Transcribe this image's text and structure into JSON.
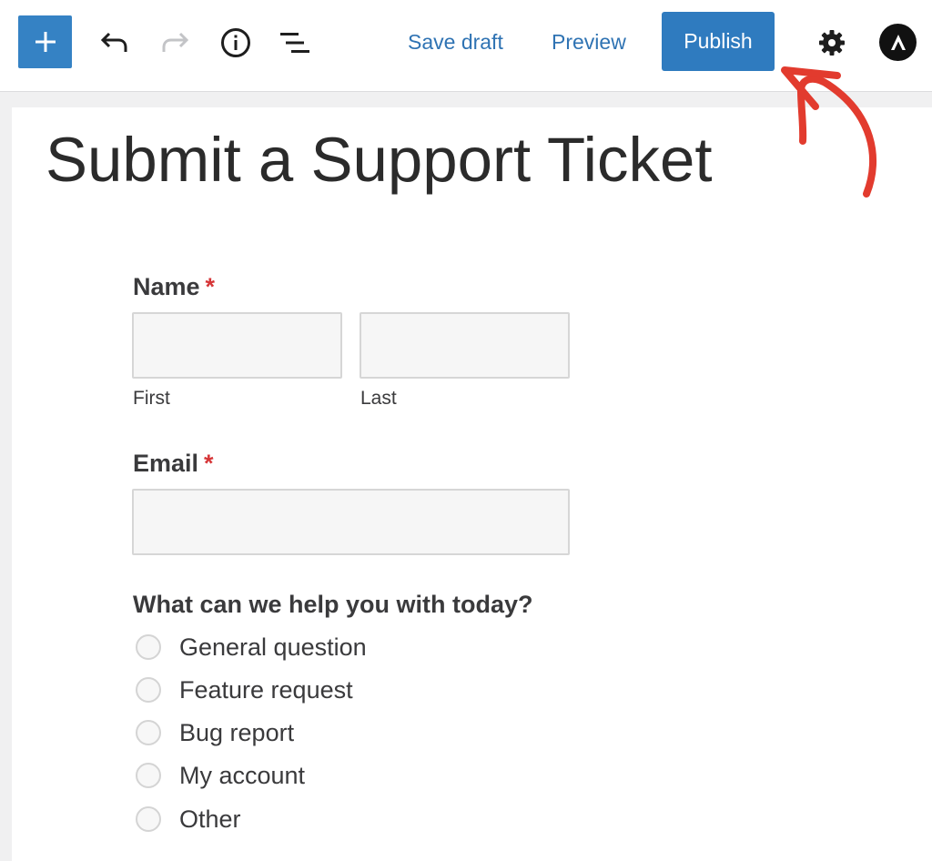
{
  "toolbar": {
    "add_icon": "plus-icon",
    "undo_icon": "undo-icon",
    "redo_icon": "redo-icon",
    "info_icon": "info-icon",
    "outline_icon": "list-view-icon",
    "save_draft_label": "Save draft",
    "preview_label": "Preview",
    "publish_label": "Publish",
    "settings_icon": "gear-icon",
    "astra_icon": "astra-logo-icon"
  },
  "colors": {
    "accent": "#3582c4",
    "link": "#2f73b3",
    "required": "#d63638",
    "annotation": "#e23b2e"
  },
  "page": {
    "title": "Submit a Support Ticket"
  },
  "form": {
    "name": {
      "label": "Name",
      "required_mark": "*",
      "first_value": "",
      "last_value": "",
      "first_sublabel": "First",
      "last_sublabel": "Last"
    },
    "email": {
      "label": "Email",
      "required_mark": "*",
      "value": ""
    },
    "help": {
      "label": "What can we help you with today?",
      "options": [
        {
          "label": "General question",
          "checked": false
        },
        {
          "label": "Feature request",
          "checked": false
        },
        {
          "label": "Bug report",
          "checked": false
        },
        {
          "label": "My account",
          "checked": false
        },
        {
          "label": "Other",
          "checked": false
        }
      ]
    }
  }
}
